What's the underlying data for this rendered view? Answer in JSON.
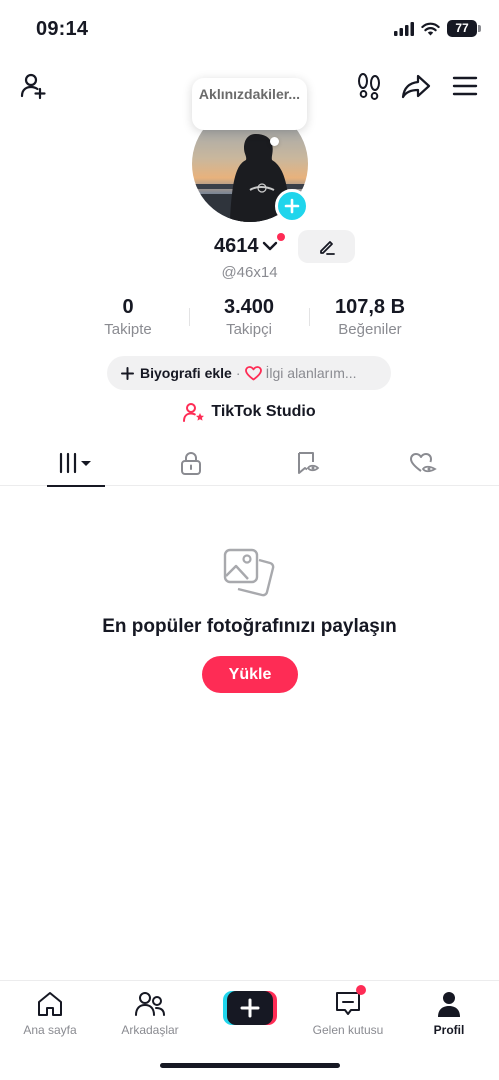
{
  "status_bar": {
    "time": "09:14",
    "battery": "77"
  },
  "profile": {
    "thought_bubble": "Aklınızdakiler...",
    "username": "4614",
    "handle": "@46x14"
  },
  "stats": [
    {
      "value": "0",
      "label": "Takipte"
    },
    {
      "value": "3.400",
      "label": "Takipçi"
    },
    {
      "value": "107,8 B",
      "label": "Beğeniler"
    }
  ],
  "bio": {
    "add_label": "Biyografi ekle",
    "separator": "·",
    "interests_label": "İlgi alanlarım..."
  },
  "studio": {
    "label": "TikTok Studio"
  },
  "empty_state": {
    "title": "En popüler fotoğrafınızı paylaşın",
    "button": "Yükle"
  },
  "bottom_nav": [
    {
      "label": "Ana sayfa"
    },
    {
      "label": "Arkadaşlar"
    },
    {
      "label": ""
    },
    {
      "label": "Gelen kutusu"
    },
    {
      "label": "Profil"
    }
  ],
  "colors": {
    "accent": "#fe2c55",
    "cyan": "#20d5ec",
    "text": "#161823",
    "muted": "#8a8b91"
  }
}
